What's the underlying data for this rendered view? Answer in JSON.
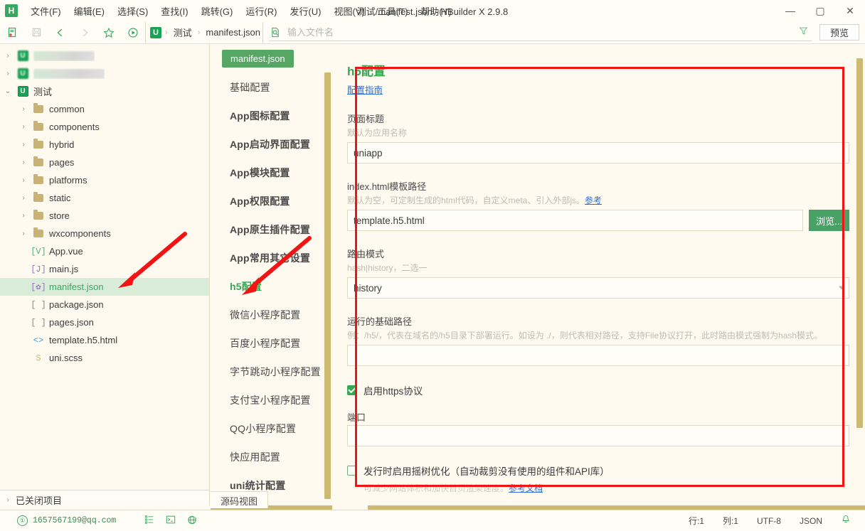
{
  "window": {
    "app_logo": "H",
    "title": "测试/manifest.json - HBuilder X 2.9.8",
    "minimize": "—",
    "maximize": "▢",
    "close": "✕"
  },
  "menubar": {
    "items": [
      {
        "label": "文件(F)"
      },
      {
        "label": "编辑(E)"
      },
      {
        "label": "选择(S)"
      },
      {
        "label": "查找(I)"
      },
      {
        "label": "跳转(G)"
      },
      {
        "label": "运行(R)"
      },
      {
        "label": "发行(U)"
      },
      {
        "label": "视图(V)"
      },
      {
        "label": "工具(T)"
      },
      {
        "label": "帮助(Y)"
      }
    ]
  },
  "toolbar": {
    "icons": [
      {
        "name": "new-file-icon"
      },
      {
        "name": "save-icon"
      },
      {
        "name": "back-icon"
      },
      {
        "name": "forward-icon"
      },
      {
        "name": "favorite-star-icon"
      },
      {
        "name": "run-icon"
      }
    ],
    "breadcrumb": {
      "logo": "U",
      "project": "测试",
      "file": "manifest.json",
      "separator": "›"
    },
    "search": {
      "placeholder": "输入文件名",
      "value": ""
    },
    "preview_label": "预览"
  },
  "filetree": {
    "items": [
      {
        "indent": 0,
        "twisty": "›",
        "icon": "uni-project-icon",
        "label": "",
        "redacted": true,
        "redact_width": 86,
        "selected": false
      },
      {
        "indent": 0,
        "twisty": "›",
        "icon": "uni-project-icon",
        "label": "",
        "redacted": true,
        "redact_width": 100,
        "selected": false
      },
      {
        "indent": 0,
        "twisty": "⌄",
        "icon": "uni-project-icon",
        "label": "测试",
        "redacted": false,
        "selected": false
      },
      {
        "indent": 1,
        "twisty": "›",
        "icon": "folder-icon",
        "label": "common",
        "selected": false
      },
      {
        "indent": 1,
        "twisty": "›",
        "icon": "folder-icon",
        "label": "components",
        "selected": false
      },
      {
        "indent": 1,
        "twisty": "›",
        "icon": "folder-icon",
        "label": "hybrid",
        "selected": false
      },
      {
        "indent": 1,
        "twisty": "›",
        "icon": "folder-icon",
        "label": "pages",
        "selected": false
      },
      {
        "indent": 1,
        "twisty": "›",
        "icon": "folder-icon",
        "label": "platforms",
        "selected": false
      },
      {
        "indent": 1,
        "twisty": "›",
        "icon": "folder-icon",
        "label": "static",
        "selected": false
      },
      {
        "indent": 1,
        "twisty": "›",
        "icon": "folder-icon",
        "label": "store",
        "selected": false
      },
      {
        "indent": 1,
        "twisty": "›",
        "icon": "folder-icon",
        "label": "wxcomponents",
        "selected": false
      },
      {
        "indent": 1,
        "twisty": "",
        "icon": "vue-file-icon",
        "glyph": "[V]",
        "glyph_color": "#4fae82",
        "label": "App.vue",
        "selected": false
      },
      {
        "indent": 1,
        "twisty": "",
        "icon": "js-file-icon",
        "glyph": "[J]",
        "glyph_color": "#9a73c6",
        "label": "main.js",
        "selected": false
      },
      {
        "indent": 1,
        "twisty": "",
        "icon": "manifest-file-icon",
        "glyph": "[✿]",
        "glyph_color": "#9a73c6",
        "label": "manifest.json",
        "selected": true
      },
      {
        "indent": 1,
        "twisty": "",
        "icon": "json-file-icon",
        "glyph": "[ ]",
        "glyph_color": "#8a8a7a",
        "label": "package.json",
        "selected": false
      },
      {
        "indent": 1,
        "twisty": "",
        "icon": "json-file-icon",
        "glyph": "[ ]",
        "glyph_color": "#8a8a7a",
        "label": "pages.json",
        "selected": false
      },
      {
        "indent": 1,
        "twisty": "",
        "icon": "html-file-icon",
        "glyph": "<>",
        "glyph_color": "#3d9bd6",
        "label": "template.h5.html",
        "selected": false
      },
      {
        "indent": 1,
        "twisty": "",
        "icon": "scss-file-icon",
        "glyph": "S",
        "glyph_color": "#c9b275",
        "label": "uni.scss",
        "selected": false
      }
    ],
    "closed_projects": "已关闭项目",
    "closed_projects_twisty": "›"
  },
  "navpanel": {
    "tab_chip": "manifest.json",
    "items": [
      {
        "label": "基础配置",
        "active": false,
        "bold": false
      },
      {
        "label": "App图标配置",
        "active": false,
        "bold": true
      },
      {
        "label": "App启动界面配置",
        "active": false,
        "bold": true
      },
      {
        "label": "App模块配置",
        "active": false,
        "bold": true
      },
      {
        "label": "App权限配置",
        "active": false,
        "bold": true
      },
      {
        "label": "App原生插件配置",
        "active": false,
        "bold": true
      },
      {
        "label": "App常用其它设置",
        "active": false,
        "bold": true
      },
      {
        "label": "h5配置",
        "active": true,
        "bold": true
      },
      {
        "label": "微信小程序配置",
        "active": false,
        "bold": false
      },
      {
        "label": "百度小程序配置",
        "active": false,
        "bold": false
      },
      {
        "label": "字节跳动小程序配置",
        "active": false,
        "bold": false
      },
      {
        "label": "支付宝小程序配置",
        "active": false,
        "bold": false
      },
      {
        "label": "QQ小程序配置",
        "active": false,
        "bold": false
      },
      {
        "label": "快应用配置",
        "active": false,
        "bold": false
      },
      {
        "label": "uni统计配置",
        "active": false,
        "bold": true
      },
      {
        "label": "源码视图",
        "active": false,
        "bold": false
      }
    ]
  },
  "form": {
    "section_title": "h5配置",
    "guide_link": "配置指南",
    "page_title": {
      "label": "页面标题",
      "hint": "默认为应用名称",
      "value": "uniapp"
    },
    "index_template": {
      "label": "index.html模板路径",
      "hint_prefix": "默认为空，可定制生成的html代码，自定义meta、引入外部js。",
      "hint_link": "参考",
      "value": "template.h5.html",
      "browse_label": "浏览..."
    },
    "router_mode": {
      "label": "路由模式",
      "hint": "hash|history，二选一",
      "value": "history",
      "options": [
        "hash",
        "history"
      ]
    },
    "base_path": {
      "label": "运行的基础路径",
      "hint": "例：/h5/，代表在域名的/h5目录下部署运行。如设为 ./，则代表相对路径，支持File协议打开，此时路由模式强制为hash模式。",
      "value": ""
    },
    "https": {
      "label": "启用https协议",
      "checked": true
    },
    "port": {
      "label": "端口",
      "value": ""
    },
    "treeshaking": {
      "label": "发行时启用摇树优化（自动裁剪没有使用的组件和API库）",
      "checked": false,
      "sub_hint_prefix": "可减少网站体积和加快首页渲染速度。",
      "sub_hint_link": "参考文档"
    }
  },
  "bottom_tabs": [
    {
      "label": "源码视图",
      "active": true
    }
  ],
  "statusbar": {
    "user_email": "1657567199@qq.com",
    "icons": [
      {
        "name": "outline-icon"
      },
      {
        "name": "terminal-icon"
      },
      {
        "name": "network-icon"
      }
    ],
    "line": "行:1",
    "column": "列:1",
    "encoding": "UTF-8",
    "language": "JSON",
    "bell": "🔔"
  },
  "colors": {
    "accent_green": "#36a853",
    "background": "#fffaf0",
    "panel": "#fffdf6",
    "scrollbar": "#cdb972",
    "annotation_red": "#f01414",
    "link_blue": "#2b6fd6",
    "selected_row": "#d8ecd8"
  }
}
